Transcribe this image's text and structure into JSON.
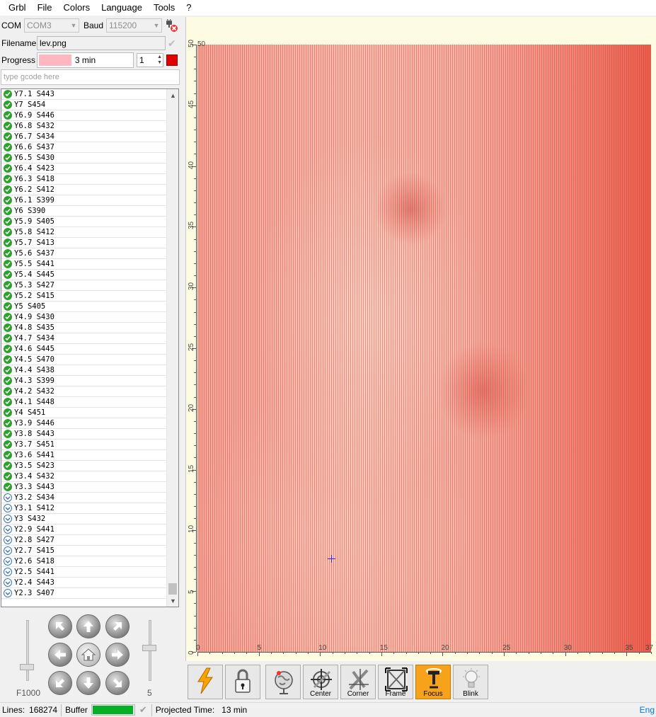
{
  "menu": [
    "Grbl",
    "File",
    "Colors",
    "Language",
    "Tools",
    "?"
  ],
  "connection": {
    "com_label": "COM",
    "com_value": "COM3",
    "baud_label": "Baud",
    "baud_value": "115200",
    "disconnect_icon": "plug-x-icon"
  },
  "file": {
    "filename_label": "Filename",
    "filename_value": "lev.png",
    "progress_label": "Progress",
    "progress_text": "3 min",
    "progress_fraction": 0.35,
    "copies_value": "1"
  },
  "gcode_input": {
    "placeholder": "type gcode here"
  },
  "gcode_list": [
    {
      "text": "Y7.1 S443",
      "state": "done"
    },
    {
      "text": "Y7 S454",
      "state": "done"
    },
    {
      "text": "Y6.9 S446",
      "state": "done"
    },
    {
      "text": "Y6.8 S432",
      "state": "done"
    },
    {
      "text": "Y6.7 S434",
      "state": "done"
    },
    {
      "text": "Y6.6 S437",
      "state": "done"
    },
    {
      "text": "Y6.5 S430",
      "state": "done"
    },
    {
      "text": "Y6.4 S423",
      "state": "done"
    },
    {
      "text": "Y6.3 S418",
      "state": "done"
    },
    {
      "text": "Y6.2 S412",
      "state": "done"
    },
    {
      "text": "Y6.1 S399",
      "state": "done"
    },
    {
      "text": "Y6 S390",
      "state": "done"
    },
    {
      "text": "Y5.9 S405",
      "state": "done"
    },
    {
      "text": "Y5.8 S412",
      "state": "done"
    },
    {
      "text": "Y5.7 S413",
      "state": "done"
    },
    {
      "text": "Y5.6 S437",
      "state": "done"
    },
    {
      "text": "Y5.5 S441",
      "state": "done"
    },
    {
      "text": "Y5.4 S445",
      "state": "done"
    },
    {
      "text": "Y5.3 S427",
      "state": "done"
    },
    {
      "text": "Y5.2 S415",
      "state": "done"
    },
    {
      "text": "Y5 S405",
      "state": "done"
    },
    {
      "text": "Y4.9 S430",
      "state": "done"
    },
    {
      "text": "Y4.8 S435",
      "state": "done"
    },
    {
      "text": "Y4.7 S434",
      "state": "done"
    },
    {
      "text": "Y4.6 S445",
      "state": "done"
    },
    {
      "text": "Y4.5 S470",
      "state": "done"
    },
    {
      "text": "Y4.4 S438",
      "state": "done"
    },
    {
      "text": "Y4.3 S399",
      "state": "done"
    },
    {
      "text": "Y4.2 S432",
      "state": "done"
    },
    {
      "text": "Y4.1 S448",
      "state": "done"
    },
    {
      "text": "Y4 S451",
      "state": "done"
    },
    {
      "text": "Y3.9 S446",
      "state": "done"
    },
    {
      "text": "Y3.8 S443",
      "state": "done"
    },
    {
      "text": "Y3.7 S451",
      "state": "done"
    },
    {
      "text": "Y3.6 S441",
      "state": "done"
    },
    {
      "text": "Y3.5 S423",
      "state": "done"
    },
    {
      "text": "Y3.4 S432",
      "state": "done"
    },
    {
      "text": "Y3.3 S443",
      "state": "done"
    },
    {
      "text": "Y3.2 S434",
      "state": "pending"
    },
    {
      "text": "Y3.1 S412",
      "state": "pending"
    },
    {
      "text": "Y3 S432",
      "state": "pending"
    },
    {
      "text": "Y2.9 S441",
      "state": "pending"
    },
    {
      "text": "Y2.8 S427",
      "state": "pending"
    },
    {
      "text": "Y2.7 S415",
      "state": "pending"
    },
    {
      "text": "Y2.6 S418",
      "state": "pending"
    },
    {
      "text": "Y2.5 S441",
      "state": "pending"
    },
    {
      "text": "Y2.4 S443",
      "state": "pending"
    },
    {
      "text": "Y2.3 S407",
      "state": "pending"
    }
  ],
  "jog": {
    "speed_label": "F1000",
    "step_label": "5",
    "speed_fraction": 0.2,
    "step_fraction": 0.55,
    "buttons": [
      "arrow-up-left-icon",
      "arrow-up-icon",
      "arrow-up-right-icon",
      "arrow-left-icon",
      "home-icon",
      "arrow-right-icon",
      "arrow-down-left-icon",
      "arrow-down-icon",
      "arrow-down-right-icon"
    ]
  },
  "view": {
    "x_ticks": [
      "0",
      "5",
      "10",
      "15",
      "20",
      "25",
      "30",
      "35"
    ],
    "x_max": "37",
    "y_ticks": [
      "0",
      "5",
      "10",
      "15",
      "20",
      "25",
      "30",
      "35",
      "40",
      "45",
      "50"
    ],
    "y_top": "50",
    "laser_position": {
      "x": 10.9,
      "y": 7.7
    },
    "image_color": "#e9604e"
  },
  "toolbar": [
    {
      "name": "reset-button",
      "icon": "lightning-icon",
      "label": ""
    },
    {
      "name": "unlock-button",
      "icon": "padlock-icon",
      "label": ""
    },
    {
      "name": "goto-origin-button",
      "icon": "globe-pin-icon",
      "label": ""
    },
    {
      "name": "center-button",
      "icon": "crosshair-target-icon",
      "label": "Center"
    },
    {
      "name": "corner-button",
      "icon": "corner-target-icon",
      "label": "Corner"
    },
    {
      "name": "frame-button",
      "icon": "frame-icon",
      "label": "Frame"
    },
    {
      "name": "focus-button",
      "icon": "focus-icon",
      "label": "Focus"
    },
    {
      "name": "blink-button",
      "icon": "bulb-icon",
      "label": "Blink"
    }
  ],
  "status": {
    "lines_label": "Lines:",
    "lines_value": "168274",
    "buffer_label": "Buffer",
    "buffer_fraction": 0.98,
    "projected_label": "Projected Time:",
    "projected_value": "13 min",
    "lang": "Eng"
  }
}
